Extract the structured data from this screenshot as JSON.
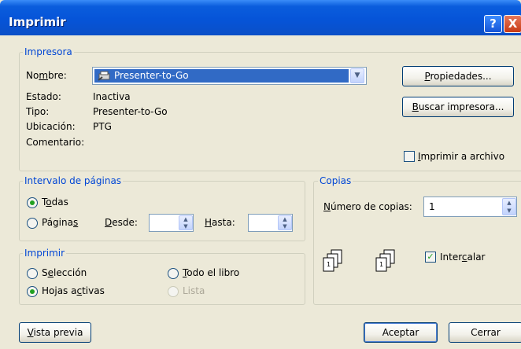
{
  "window": {
    "title": "Imprimir",
    "help": "?",
    "close": "X"
  },
  "printer": {
    "group_label": "Impresora",
    "name_label": "Nombre:",
    "name_value": "Presenter-to-Go",
    "status_label": "Estado:",
    "status_value": "Inactiva",
    "type_label": "Tipo:",
    "type_value": "Presenter-to-Go",
    "location_label": "Ubicación:",
    "location_value": "PTG",
    "comment_label": "Comentario:",
    "properties_button": "Propiedades...",
    "find_button": "Buscar impresora...",
    "print_to_file": "Imprimir a archivo"
  },
  "range": {
    "group_label": "Intervalo de páginas",
    "all": "Todas",
    "pages": "Páginas",
    "from_label": "Desde:",
    "to_label": "Hasta:",
    "selected": "all"
  },
  "print_what": {
    "group_label": "Imprimir",
    "selection": "Selección",
    "active_sheets": "Hojas activas",
    "whole_book": "Todo el libro",
    "list": "Lista",
    "selected": "active_sheets"
  },
  "copies": {
    "group_label": "Copias",
    "count_label": "Número de copias:",
    "count_value": "1",
    "collate": "Intercalar",
    "collate_checked": true
  },
  "footer": {
    "preview_button": "Vista previa",
    "ok_button": "Aceptar",
    "cancel_button": "Cerrar"
  }
}
